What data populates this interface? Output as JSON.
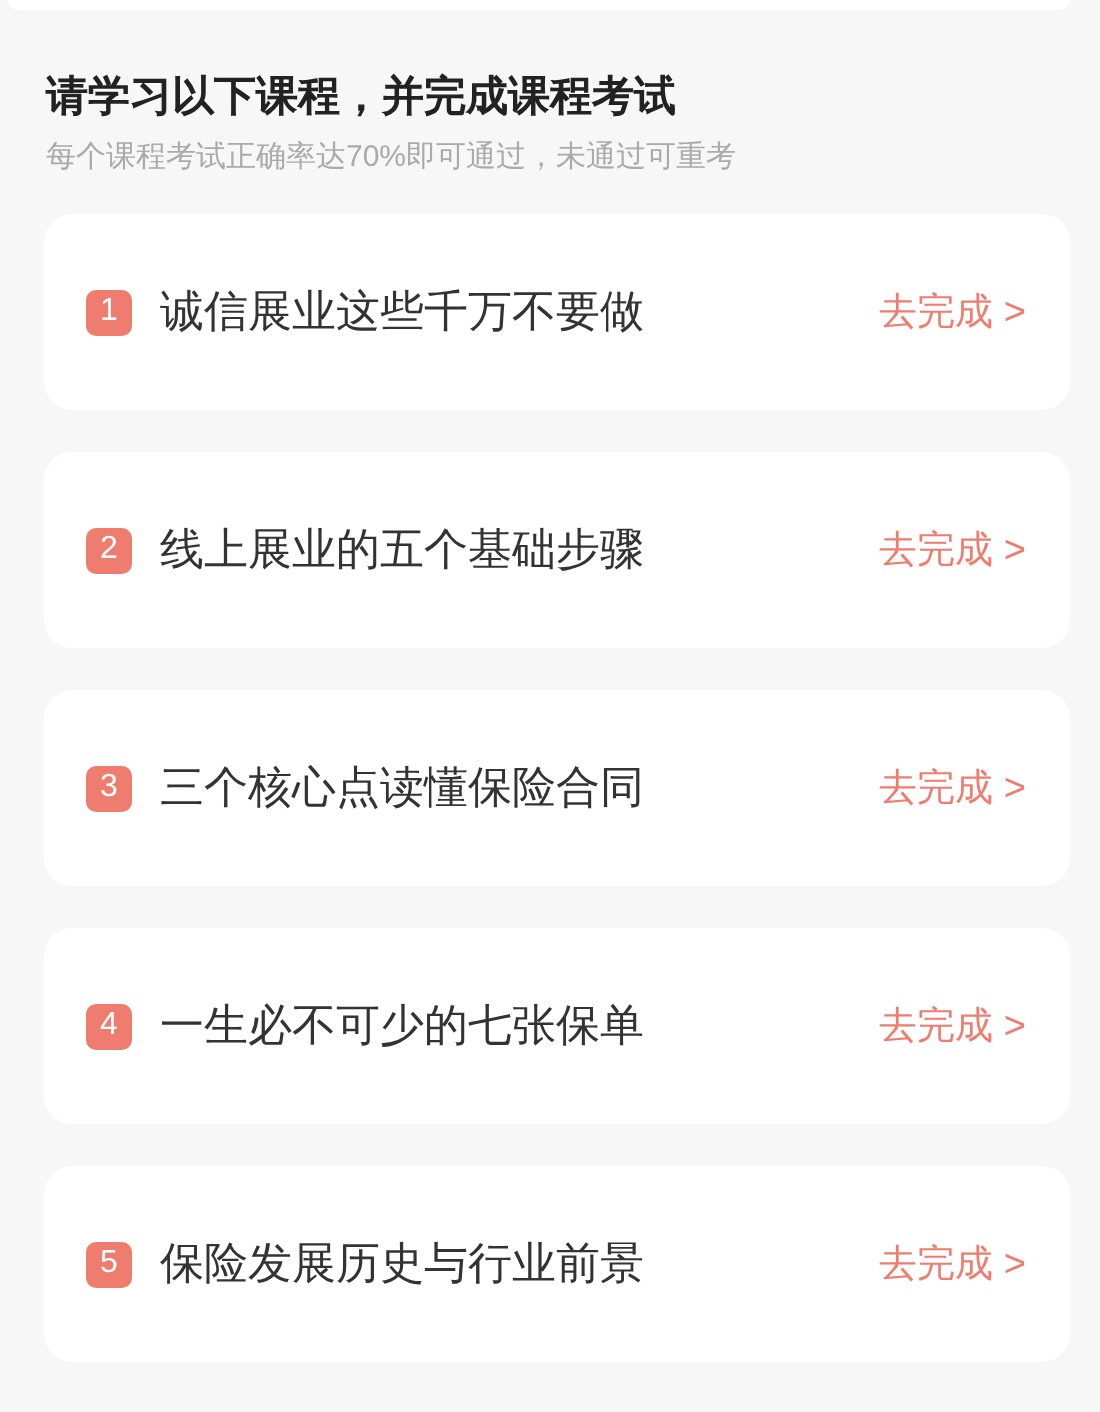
{
  "heading": "请学习以下课程，并完成课程考试",
  "subheading": "每个课程考试正确率达70%即可通过，未通过可重考",
  "courses": [
    {
      "number": "1",
      "title": "诚信展业这些千万不要做",
      "action": "去完成 >"
    },
    {
      "number": "2",
      "title": "线上展业的五个基础步骤",
      "action": "去完成 >"
    },
    {
      "number": "3",
      "title": "三个核心点读懂保险合同",
      "action": "去完成 >"
    },
    {
      "number": "4",
      "title": "一生必不可少的七张保单",
      "action": "去完成 >"
    },
    {
      "number": "5",
      "title": "保险发展历史与行业前景",
      "action": "去完成 >"
    }
  ]
}
